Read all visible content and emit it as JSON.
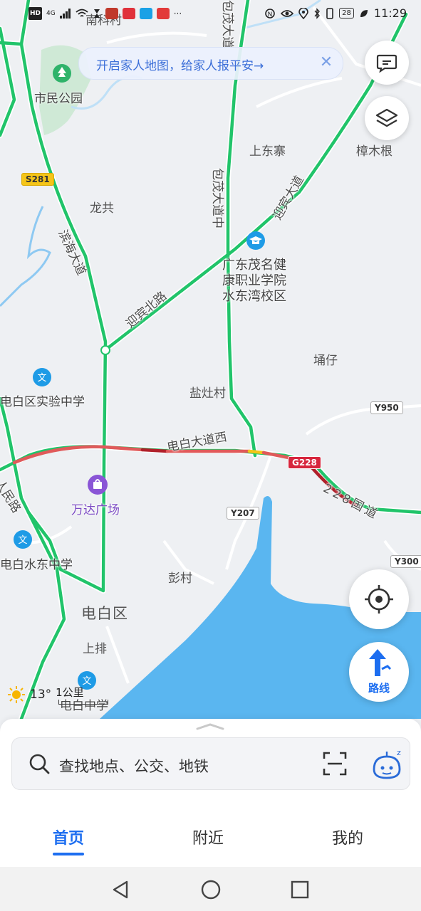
{
  "status_bar": {
    "time": "11:29",
    "battery": "28",
    "signal": "4G"
  },
  "banner": {
    "text": "开启家人地图，给家人报平安→"
  },
  "map": {
    "places": {
      "civic_park": "市民公园",
      "shangdongzhai": "上东寨",
      "zhangmugen": "樟木根",
      "longgong": "龙共",
      "tongzai": "埇仔",
      "yanzaocun": "盐灶村",
      "pengcun": "彭村",
      "shangpai": "上排",
      "district": "电白区",
      "top_partial": "南科村"
    },
    "pois": {
      "college_line1": "广东茂名健",
      "college_line2": "康职业学院",
      "college_line3": "水东湾校区",
      "experiment_school": "电白区实验中学",
      "wanda": "万达广场",
      "shuidong_school": "电白水东中学",
      "dianbai_school": "电白中学"
    },
    "roads": {
      "baomao": "包茂大道中",
      "yingbin_bei": "迎宾北路",
      "yingbin_da": "迎宾大道",
      "huanan": "滨海大道",
      "dianbai_west": "电白大道西",
      "g228_name": "228国道",
      "renmin": "人民路",
      "top_partial": "包茂大道"
    },
    "shields": {
      "s281": "S281",
      "g228": "G228",
      "y950": "Y950",
      "y207": "Y207",
      "y300": "Y300"
    },
    "weather": {
      "temp": "13°",
      "scale": "1公里"
    }
  },
  "buttons": {
    "route": "路线"
  },
  "search": {
    "placeholder": "查找地点、公交、地铁"
  },
  "tabs": {
    "home": "首页",
    "nearby": "附近",
    "mine": "我的"
  },
  "colors": {
    "accent": "#1d6ef0",
    "road_green": "#21c46a",
    "water": "#5ab6f0",
    "park": "#cfe9d6",
    "congestion": "#b0202a"
  }
}
